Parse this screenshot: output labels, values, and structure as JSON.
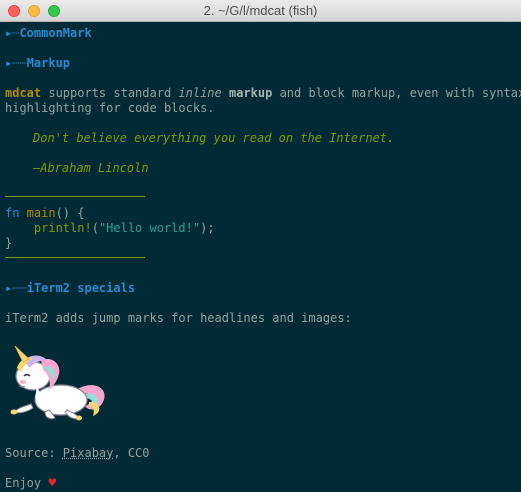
{
  "window": {
    "title": "2. ~/G/l/mdcat (fish)"
  },
  "lines": {
    "h_commonmark": "CommonMark",
    "h_markup": "Markup",
    "h_iterm": "iTerm2 specials",
    "h1_prefix": "▸┈",
    "h2_prefix": "▸┈┈",
    "p1_cmd": "mdcat",
    "p1_a": " supports standard ",
    "p1_inline": "inline",
    "p1_b": " ",
    "p1_markup": "markup",
    "p1_c": " and block markup, even with syntax",
    "p1_d": "highlighting for code blocks.",
    "quote1": "Don't believe everything you read on the Internet.",
    "quote2": "—Abraham Lincoln",
    "code_fn": "fn",
    "code_main": " main",
    "code_rest1": "() {",
    "code_indent": "    ",
    "code_macro": "println!",
    "code_open": "(",
    "code_str": "\"Hello world!\"",
    "code_close": ");",
    "code_brace": "}",
    "p2": "iTerm2 adds jump marks for headlines and images:",
    "source_label": "Source: ",
    "source_link": "Pixabay",
    "source_tail": ", CC0",
    "enjoy": "Enjoy ",
    "heart": "♥"
  },
  "colors": {
    "background": "#002b36",
    "heading": "#268bd2",
    "command": "#b58900",
    "quote": "#859900",
    "string": "#2aa198",
    "text": "#93a1a1"
  }
}
